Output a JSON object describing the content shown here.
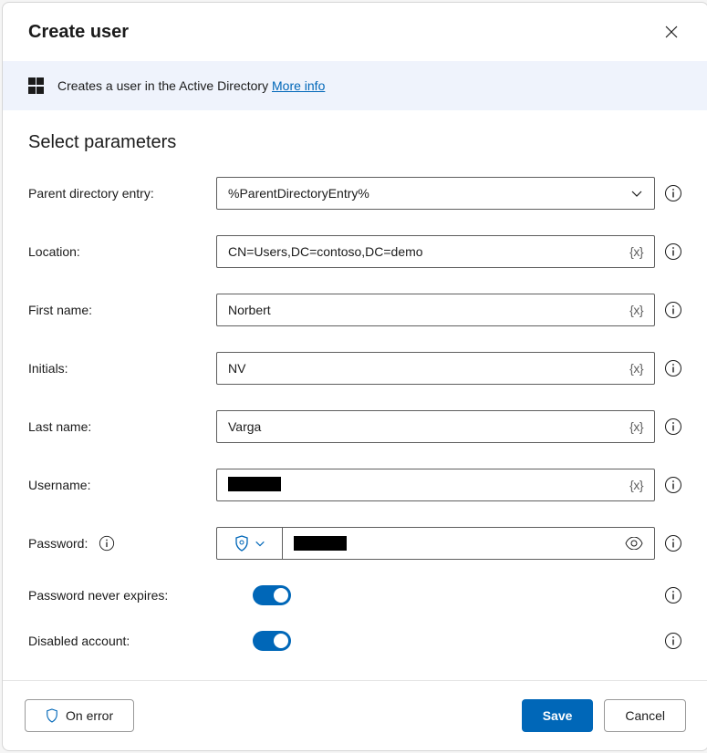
{
  "title": "Create user",
  "banner": {
    "text": "Creates a user in the Active Directory ",
    "link": "More info"
  },
  "section_title": "Select parameters",
  "labels": {
    "parent": "Parent directory entry:",
    "location": "Location:",
    "first_name": "First name:",
    "initials": "Initials:",
    "last_name": "Last name:",
    "username": "Username:",
    "password": "Password:",
    "never_expires": "Password never expires:",
    "disabled": "Disabled account:"
  },
  "values": {
    "parent": "%ParentDirectoryEntry%",
    "location": "CN=Users,DC=contoso,DC=demo",
    "first_name": "Norbert",
    "initials": "NV",
    "last_name": "Varga",
    "never_expires": true,
    "disabled": true
  },
  "var_token": "{x}",
  "footer": {
    "on_error": "On error",
    "save": "Save",
    "cancel": "Cancel"
  }
}
